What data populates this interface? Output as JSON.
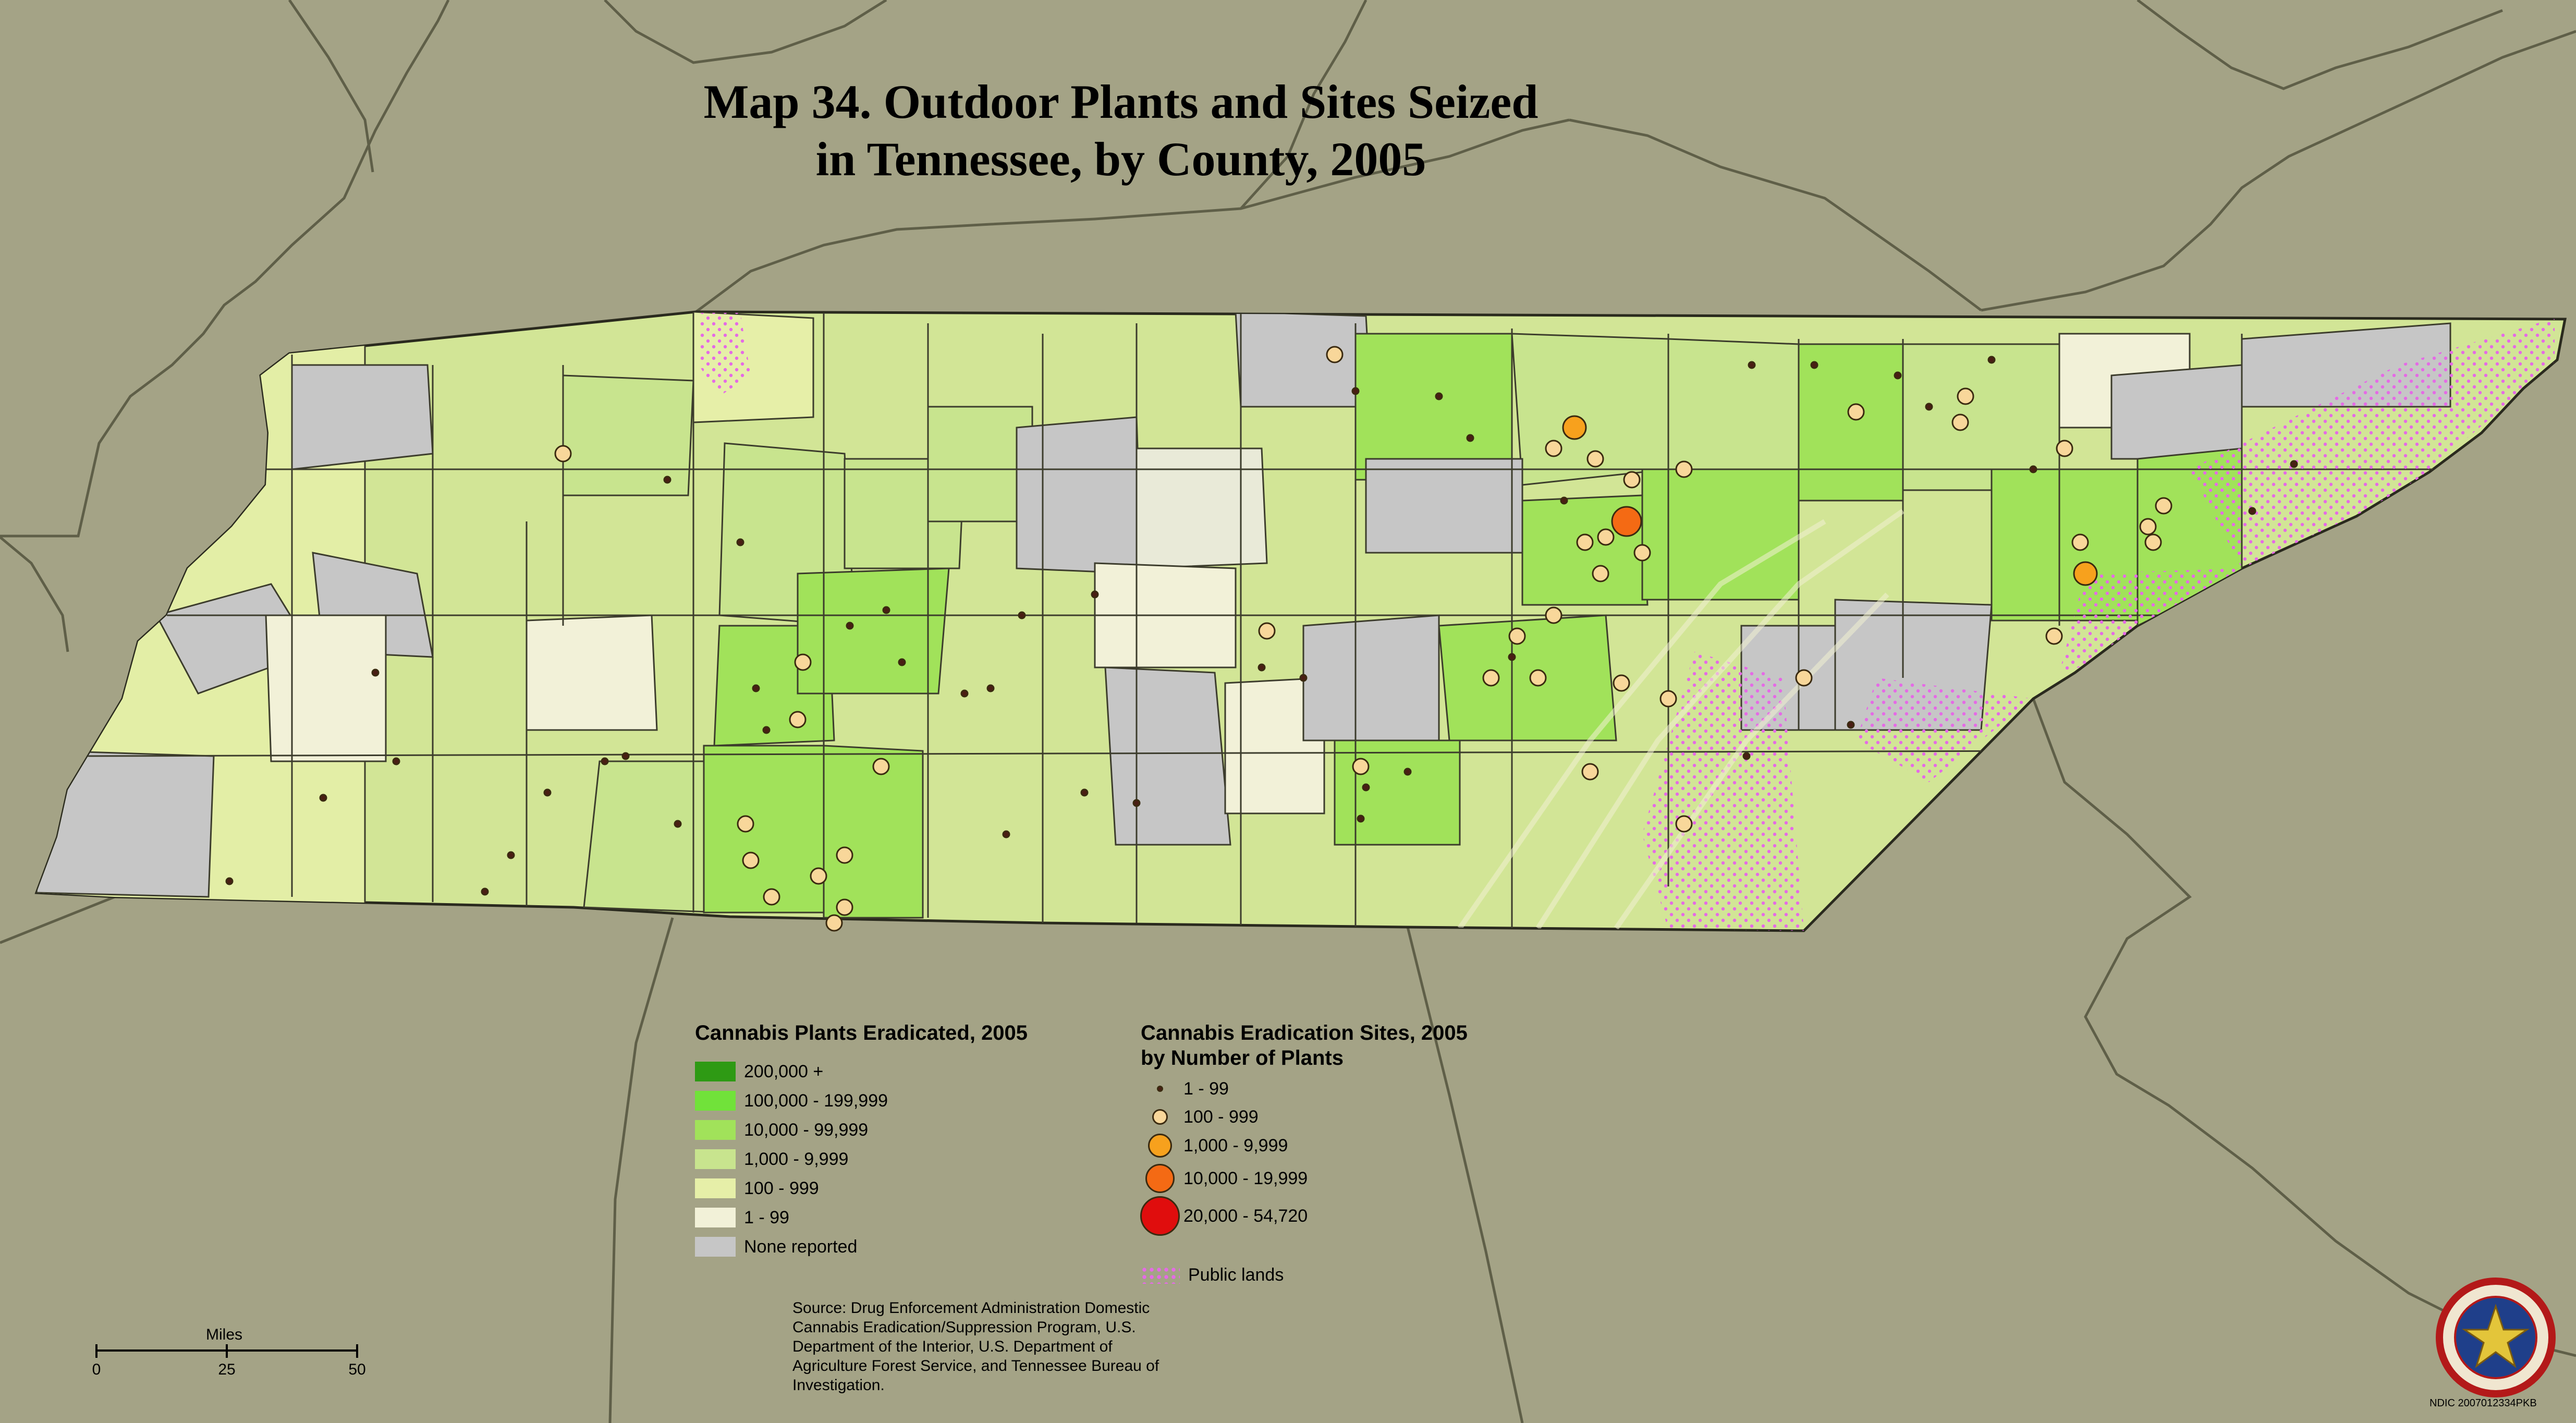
{
  "title": {
    "line1": "Map 34. Outdoor Plants and Sites Seized",
    "line2": "in Tennessee, by County, 2005"
  },
  "legend_plants": {
    "title": "Cannabis Plants Eradicated, 2005",
    "items": [
      {
        "label": "200,000 +",
        "color": "#2e9a14"
      },
      {
        "label": "100,000 - 199,999",
        "color": "#71e23a"
      },
      {
        "label": "10,000 - 99,999",
        "color": "#a1e25a"
      },
      {
        "label": "1,000 - 9,999",
        "color": "#c8e48e"
      },
      {
        "label": "100 - 999",
        "color": "#e6efa8"
      },
      {
        "label": "1 - 99",
        "color": "#f2f1d8"
      },
      {
        "label": "None reported",
        "color": "#c6c6c6"
      }
    ]
  },
  "legend_sites": {
    "title_line1": "Cannabis Eradication Sites, 2005",
    "title_line2": "by Number of Plants",
    "items": [
      {
        "label": "1 - 99",
        "color": "#4a1e14"
      },
      {
        "label": "100 - 999",
        "color": "#f8d79a"
      },
      {
        "label": "1,000 - 9,999",
        "color": "#f7a11d"
      },
      {
        "label": "10,000 - 19,999",
        "color": "#f46a14"
      },
      {
        "label": "20,000 - 54,720",
        "color": "#e00d0d"
      }
    ],
    "public_lands_label": "Public lands",
    "public_lands_color": "#e56ae6"
  },
  "source_text": "Source: Drug Enforcement Administration Domestic Cannabis Eradication/Suppression Program, U.S. Department of the Interior, U.S. Department of Agriculture Forest Service, and Tennessee Bureau of Investigation.",
  "scale": {
    "title": "Miles",
    "ticks": [
      "0",
      "25",
      "50"
    ]
  },
  "credit": "NDIC 2007012334PKB",
  "colors": {
    "background": "#a4a386",
    "border": "#5f5f48",
    "county_line": "#3c3c2c"
  },
  "seal_icon": "ndic-seal-icon"
}
